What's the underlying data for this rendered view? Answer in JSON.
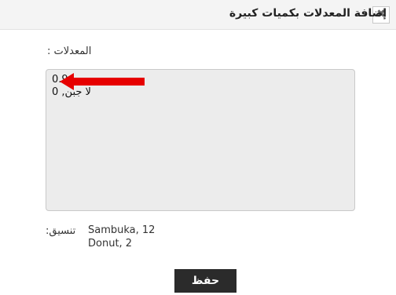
{
  "dialog": {
    "title": "إضافة المعدلات بكميات كبيرة",
    "close_icon": "close-icon"
  },
  "form": {
    "rates_label": ": المعدلات",
    "rates_value": "0.9\nلا جبن, 0",
    "format_label": ":تنسيق",
    "format_example_lines": [
      "Sambuka, 12",
      "Donut, 2"
    ]
  },
  "actions": {
    "save_label": "حفظ"
  },
  "colors": {
    "arrow": "#e60000",
    "save_button": "#2b2b2b"
  }
}
